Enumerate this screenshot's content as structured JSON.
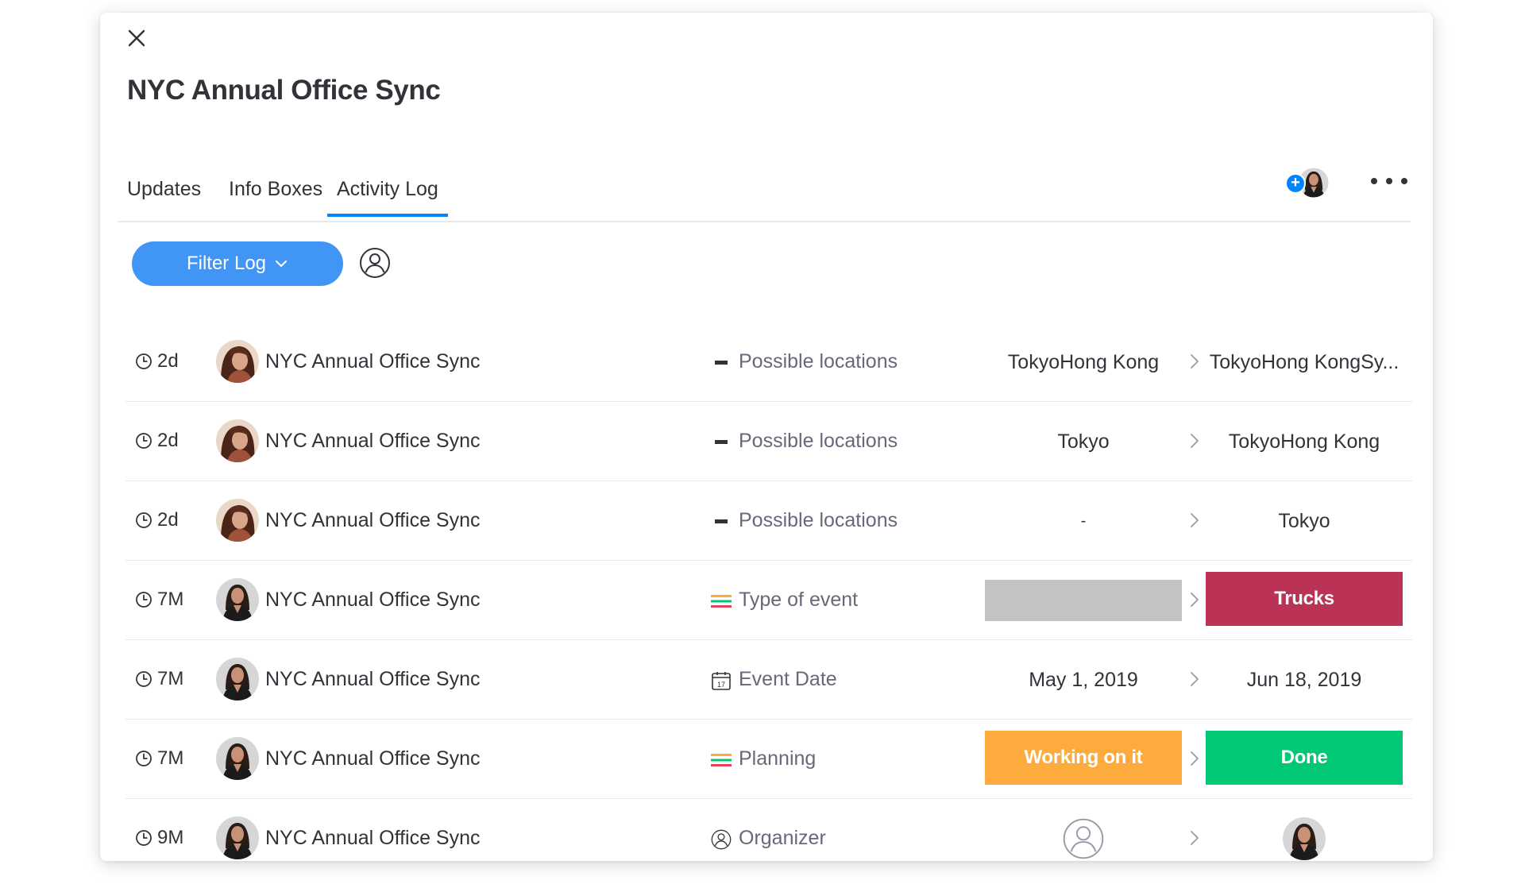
{
  "item": {
    "title": "NYC Annual Office Sync"
  },
  "tabs": [
    {
      "label": "Updates",
      "active": false
    },
    {
      "label": "Info Boxes",
      "active": false
    },
    {
      "label": "Activity Log",
      "active": true
    }
  ],
  "toolbar": {
    "filter_label": "Filter Log"
  },
  "colors": {
    "accent": "#0085ff",
    "filter_button": "#4196f5",
    "status_empty": "#c4c4c4",
    "status_trucks": "#bb3354",
    "status_working": "#fdab3d",
    "status_done": "#00c875"
  },
  "activity": [
    {
      "time": "2d",
      "item": "NYC Annual Office Sync",
      "column": "Possible locations",
      "column_icon": "text-icon",
      "old": "TokyoHong Kong",
      "new": "TokyoHong KongSy..."
    },
    {
      "time": "2d",
      "item": "NYC Annual Office Sync",
      "column": "Possible locations",
      "column_icon": "text-icon",
      "old": "Tokyo",
      "new": "TokyoHong Kong"
    },
    {
      "time": "2d",
      "item": "NYC Annual Office Sync",
      "column": "Possible locations",
      "column_icon": "text-icon",
      "old": "-",
      "new": "Tokyo"
    },
    {
      "time": "7M",
      "item": "NYC Annual Office Sync",
      "column": "Type of event",
      "column_icon": "status-icon",
      "old": "",
      "new": "Trucks"
    },
    {
      "time": "7M",
      "item": "NYC Annual Office Sync",
      "column": "Event Date",
      "column_icon": "calendar-icon",
      "old": "May 1, 2019",
      "new": "Jun 18, 2019"
    },
    {
      "time": "7M",
      "item": "NYC Annual Office Sync",
      "column": "Planning",
      "column_icon": "status-icon",
      "old": "Working on it",
      "new": "Done"
    },
    {
      "time": "9M",
      "item": "NYC Annual Office Sync",
      "column": "Organizer",
      "column_icon": "person-icon",
      "old": "",
      "new": ""
    }
  ]
}
